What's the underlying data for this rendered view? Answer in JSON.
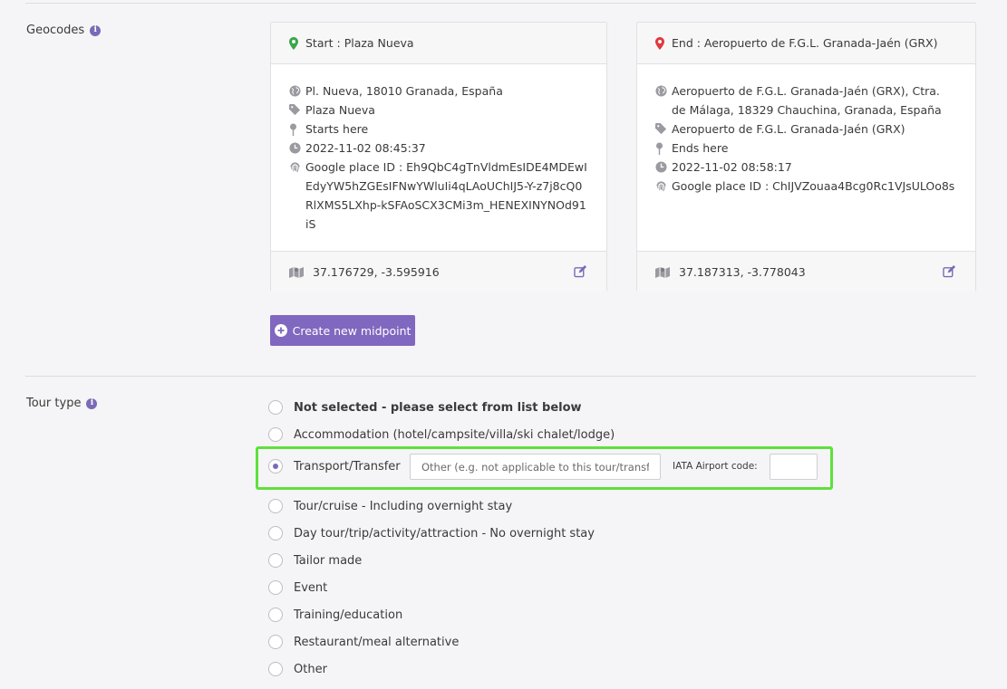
{
  "geocodes": {
    "label": "Geocodes",
    "start": {
      "title": "Start : Plaza Nueva",
      "address": "Pl. Nueva, 18010 Granada, España",
      "tag": "Plaza Nueva",
      "note": "Starts here",
      "datetime": "2022-11-02 08:45:37",
      "place_id": "Google place ID : Eh9QbC4gTnVldmEsIDE4MDEwIEdyYW5hZGEsIFNwYWluIi4qLAoUChIJ5-Y-z7j8cQ0RlXMS5LXhp-kSFAoSCX3CMi3m_HENEXINYNOd91iS",
      "coords": "37.176729, -3.595916",
      "pin_color": "#3aa64a"
    },
    "end": {
      "title": "End : Aeropuerto de F.G.L. Granada-Jaén (GRX)",
      "address": "Aeropuerto de F.G.L. Granada-Jaén (GRX), Ctra. de Málaga, 18329 Chauchina, Granada, España",
      "tag": "Aeropuerto de F.G.L. Granada-Jaén (GRX)",
      "note": "Ends here",
      "datetime": "2022-11-02 08:58:17",
      "place_id": "Google place ID : ChIJVZouaa4Bcg0Rc1VJsULOo8s",
      "coords": "37.187313, -3.778043",
      "pin_color": "#e0393e"
    },
    "create_midpoint_label": "Create new midpoint"
  },
  "tour_type": {
    "label": "Tour type",
    "options": [
      "Not selected - please select from list below",
      "Accommodation (hotel/campsite/villa/ski chalet/lodge)",
      "Transport/Transfer",
      "Tour/cruise - Including overnight stay",
      "Day tour/trip/activity/attraction - No overnight stay",
      "Tailor made",
      "Event",
      "Training/education",
      "Restaurant/meal alternative",
      "Other"
    ],
    "selected": "Transport/Transfer",
    "other_placeholder": "Other (e.g. not applicable to this tour/transfer)",
    "iata_label": "IATA Airport code:",
    "iata_value": ""
  },
  "colors": {
    "accent": "#8067bf",
    "highlight": "#5fe03c"
  }
}
